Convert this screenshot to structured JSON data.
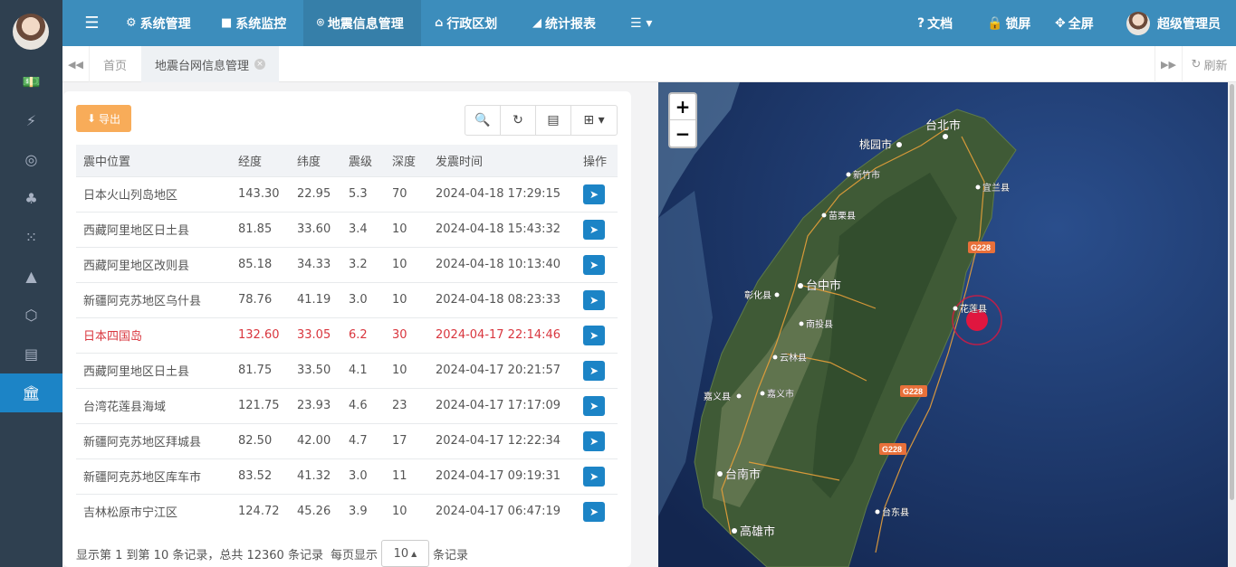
{
  "topnav": {
    "items": [
      {
        "icon": "gear-icon",
        "label": "系统管理"
      },
      {
        "icon": "video-icon",
        "label": "系统监控"
      },
      {
        "icon": "map-pin-icon",
        "label": "地震信息管理"
      },
      {
        "icon": "bank-icon",
        "label": "行政区划"
      },
      {
        "icon": "area-chart-icon",
        "label": "统计报表"
      }
    ],
    "more_icon": "list-icon",
    "right": {
      "docs": "文档",
      "lock": "锁屏",
      "fullscreen": "全屏",
      "user": "超级管理员"
    }
  },
  "sidebar": {
    "icons": [
      "money-icon",
      "bolt-icon",
      "target-icon",
      "tree-icon",
      "grid-icon",
      "chart-icon",
      "cube-icon",
      "newspaper-icon",
      "bank-icon"
    ],
    "active_index": 8
  },
  "tabs": {
    "home": "首页",
    "current": "地震台网信息管理",
    "refresh": "刷新"
  },
  "toolbar": {
    "export_label": "导出"
  },
  "table": {
    "headers": [
      "震中位置",
      "经度",
      "纬度",
      "震级",
      "深度",
      "发震时间",
      "操作"
    ],
    "rows": [
      {
        "loc": "日本火山列岛地区",
        "lon": "143.30",
        "lat": "22.95",
        "mag": "5.3",
        "depth": "70",
        "time": "2024-04-18 17:29:15",
        "hl": false
      },
      {
        "loc": "西藏阿里地区日土县",
        "lon": "81.85",
        "lat": "33.60",
        "mag": "3.4",
        "depth": "10",
        "time": "2024-04-18 15:43:32",
        "hl": false
      },
      {
        "loc": "西藏阿里地区改则县",
        "lon": "85.18",
        "lat": "34.33",
        "mag": "3.2",
        "depth": "10",
        "time": "2024-04-18 10:13:40",
        "hl": false
      },
      {
        "loc": "新疆阿克苏地区乌什县",
        "lon": "78.76",
        "lat": "41.19",
        "mag": "3.0",
        "depth": "10",
        "time": "2024-04-18 08:23:33",
        "hl": false
      },
      {
        "loc": "日本四国岛",
        "lon": "132.60",
        "lat": "33.05",
        "mag": "6.2",
        "depth": "30",
        "time": "2024-04-17 22:14:46",
        "hl": true
      },
      {
        "loc": "西藏阿里地区日土县",
        "lon": "81.75",
        "lat": "33.50",
        "mag": "4.1",
        "depth": "10",
        "time": "2024-04-17 20:21:57",
        "hl": false
      },
      {
        "loc": "台湾花莲县海域",
        "lon": "121.75",
        "lat": "23.93",
        "mag": "4.6",
        "depth": "23",
        "time": "2024-04-17 17:17:09",
        "hl": false
      },
      {
        "loc": "新疆阿克苏地区拜城县",
        "lon": "82.50",
        "lat": "42.00",
        "mag": "4.7",
        "depth": "17",
        "time": "2024-04-17 12:22:34",
        "hl": false
      },
      {
        "loc": "新疆阿克苏地区库车市",
        "lon": "83.52",
        "lat": "41.32",
        "mag": "3.0",
        "depth": "11",
        "time": "2024-04-17 09:19:31",
        "hl": false
      },
      {
        "loc": "吉林松原市宁江区",
        "lon": "124.72",
        "lat": "45.26",
        "mag": "3.9",
        "depth": "10",
        "time": "2024-04-17 06:47:19",
        "hl": false
      }
    ]
  },
  "pager": {
    "summary": "显示第 1 到第 10 条记录，总共 12360 条记录",
    "per_page_label": "每页显示",
    "page_size": "10",
    "suffix": "条记录"
  },
  "map": {
    "zoom_in": "+",
    "zoom_out": "−",
    "labels": [
      "台北市",
      "桃园市",
      "新竹市",
      "宜兰县",
      "苗栗县",
      "台中市",
      "彰化县",
      "南投县",
      "花莲县",
      "云林县",
      "嘉义县",
      "嘉义市",
      "台南市",
      "台东县",
      "高雄市",
      "G228",
      "G228",
      "G228"
    ]
  }
}
